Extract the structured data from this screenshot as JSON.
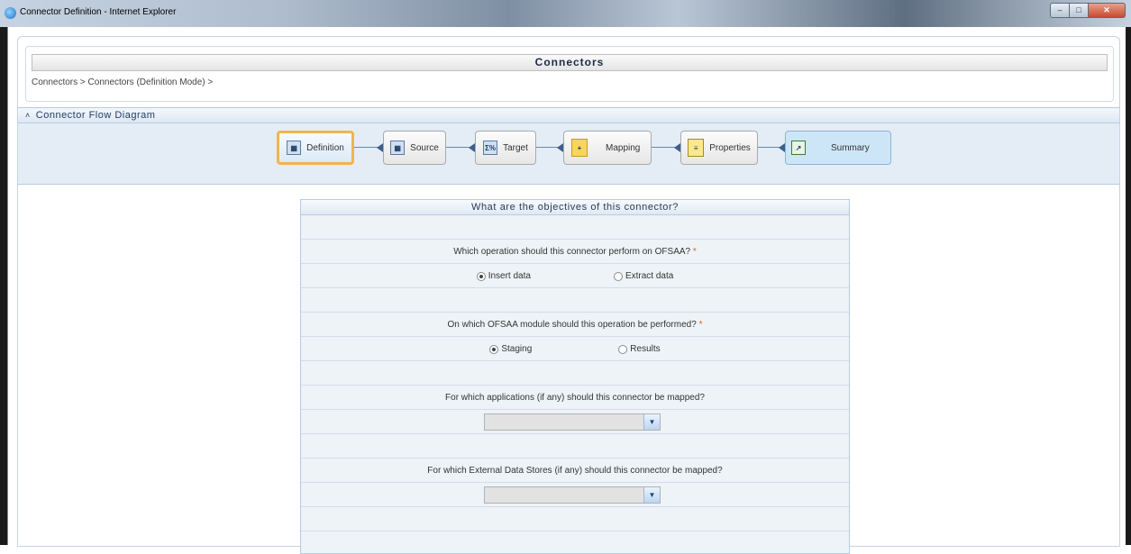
{
  "window": {
    "title": "Connector Definition - Internet Explorer",
    "controls": [
      "minimize-icon",
      "maximize-icon",
      "close-icon"
    ]
  },
  "header": {
    "title": "Connectors",
    "breadcrumb": "Connectors > Connectors (Definition Mode) >"
  },
  "flow": {
    "title": "Connector Flow Diagram",
    "steps": [
      {
        "label": "Definition",
        "icon": "definition-icon",
        "active": true
      },
      {
        "label": "Source",
        "icon": "source-icon"
      },
      {
        "label": "Target",
        "icon": "target-icon",
        "glyph": "Σ%"
      },
      {
        "label": "Mapping",
        "icon": "mapping-icon"
      },
      {
        "label": "Properties",
        "icon": "properties-icon"
      },
      {
        "label": "Summary",
        "icon": "summary-icon"
      }
    ]
  },
  "form": {
    "title": "What are the objectives of this connector?",
    "q1": {
      "text": "Which operation should this connector perform on OFSAA?",
      "required": "*",
      "options": [
        "Insert data",
        "Extract data"
      ],
      "selected": "Insert data"
    },
    "q2": {
      "text": "On which OFSAA module should this operation be performed?",
      "required": "*",
      "options": [
        "Staging",
        "Results"
      ],
      "selected": "Staging"
    },
    "q3": {
      "text": "For which applications (if any) should this connector be mapped?",
      "value": ""
    },
    "q4": {
      "text": "For which External Data Stores (if any) should this connector be mapped?",
      "value": ""
    }
  },
  "colors": {
    "accent": "#f0b54a",
    "panel": "#e4edf6",
    "required": "#e0611f"
  }
}
